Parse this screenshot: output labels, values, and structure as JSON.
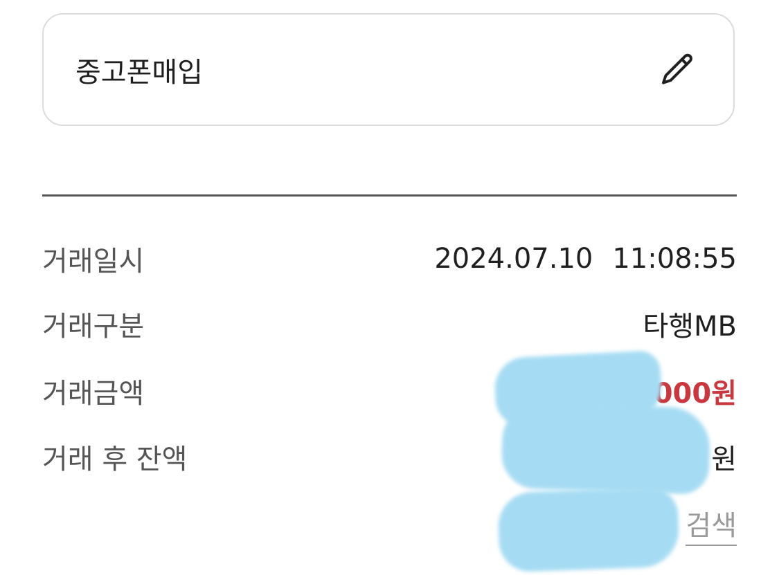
{
  "memo": {
    "text": "중고폰매입",
    "edit_icon": "pencil-icon"
  },
  "details": [
    {
      "label": "거래일시",
      "date": "2024.07.10",
      "time": "11:08:55"
    },
    {
      "label": "거래구분",
      "value": "타행MB"
    },
    {
      "label": "거래금액",
      "value": "000원",
      "color": "#c8383e"
    },
    {
      "label": "거래 후 잔액",
      "value": "원"
    }
  ],
  "search_link": {
    "label": "검색"
  },
  "colors": {
    "accent_red": "#c8383e",
    "label_gray": "#555555",
    "link_gray": "#9a9a9a",
    "redaction_blue": "#a6dcf3"
  }
}
